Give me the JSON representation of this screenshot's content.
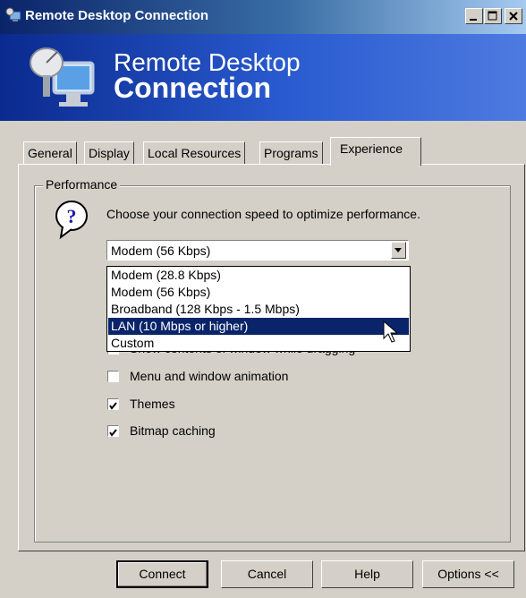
{
  "window": {
    "title": "Remote Desktop Connection",
    "minimize_icon": "minimize-icon",
    "maximize_icon": "maximize-icon",
    "close_icon": "close-icon"
  },
  "banner": {
    "subtitle": "Remote Desktop",
    "title": "Connection",
    "icon": "remote-desktop-icon"
  },
  "tabs": [
    {
      "label": "General",
      "active": false
    },
    {
      "label": "Display",
      "active": false
    },
    {
      "label": "Local Resources",
      "active": false
    },
    {
      "label": "Programs",
      "active": false
    },
    {
      "label": "Experience",
      "active": true
    }
  ],
  "performance": {
    "group_label": "Performance",
    "help_icon": "help-question-icon",
    "prompt": "Choose your connection speed to optimize performance.",
    "speed_select": {
      "value": "Modem (56 Kbps)",
      "options": [
        "Modem (28.8 Kbps)",
        "Modem (56 Kbps)",
        "Broadband (128 Kbps - 1.5 Mbps)",
        "LAN (10 Mbps or higher)",
        "Custom"
      ],
      "highlighted": "LAN (10 Mbps or higher)"
    },
    "options": [
      {
        "label": "Show contents of window while dragging",
        "checked": false
      },
      {
        "label": "Menu and window animation",
        "checked": false
      },
      {
        "label": "Themes",
        "checked": true
      },
      {
        "label": "Bitmap caching",
        "checked": true
      }
    ]
  },
  "buttons": {
    "connect": "Connect",
    "cancel": "Cancel",
    "help": "Help",
    "options": "Options <<"
  },
  "colors": {
    "titlebar_start": "#0a246a",
    "banner": "#2a5bd0",
    "selection": "#0a246a",
    "face": "#d4d0c8"
  }
}
